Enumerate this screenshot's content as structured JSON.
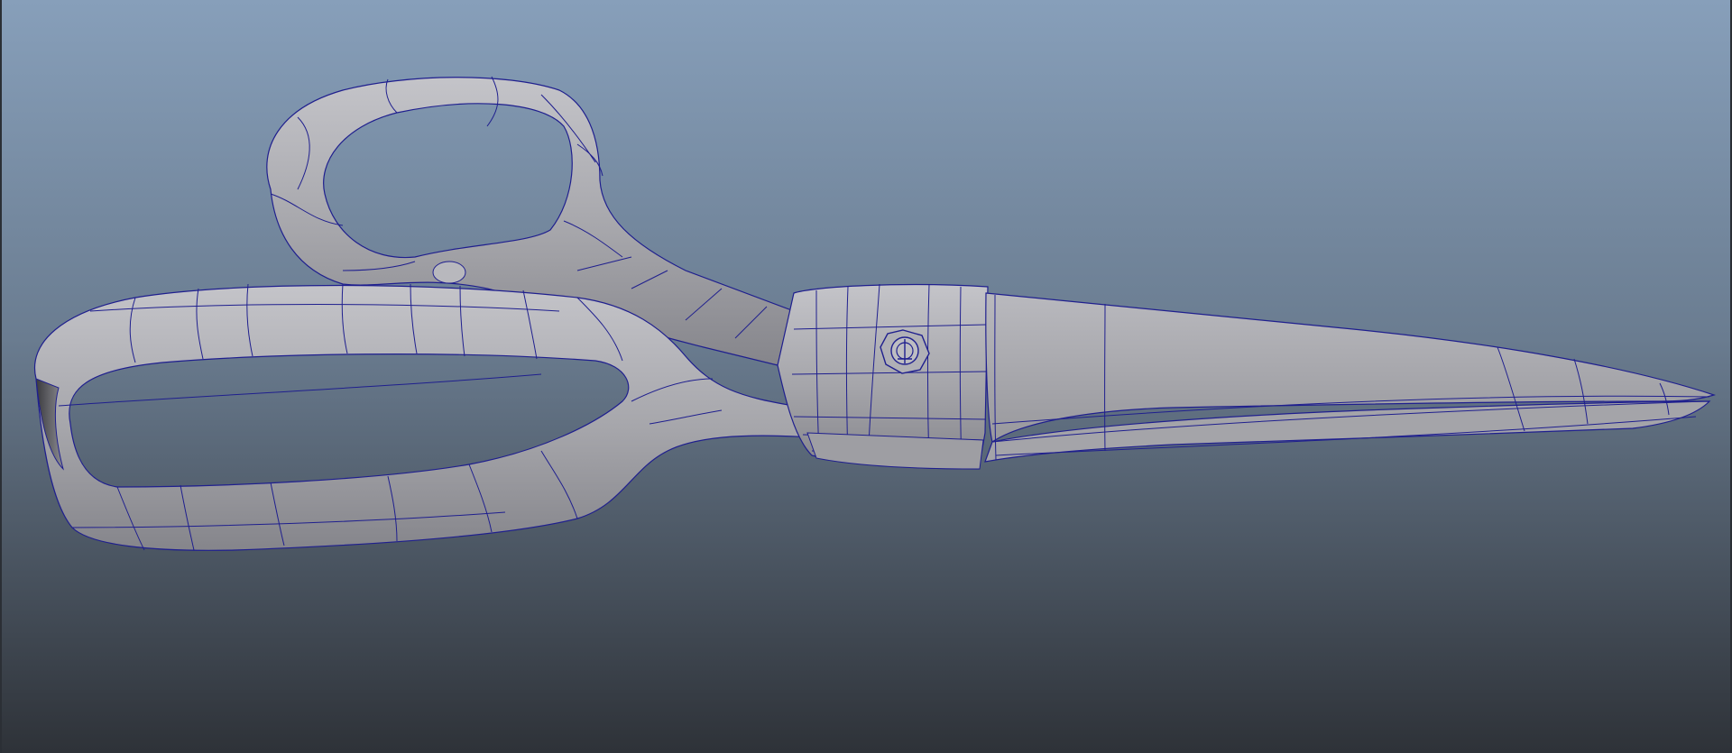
{
  "viewport": {
    "background_top": "#879fba",
    "background_mid": "#6a7c90",
    "background_bottom": "#2e3238"
  },
  "model": {
    "object": "scissors-wireframe",
    "shaded_color": "#a7a7ac",
    "wire_color": "#1f1f8e",
    "shadow_color": "#6c6c72",
    "highlight_color": "#c6c6cb"
  }
}
